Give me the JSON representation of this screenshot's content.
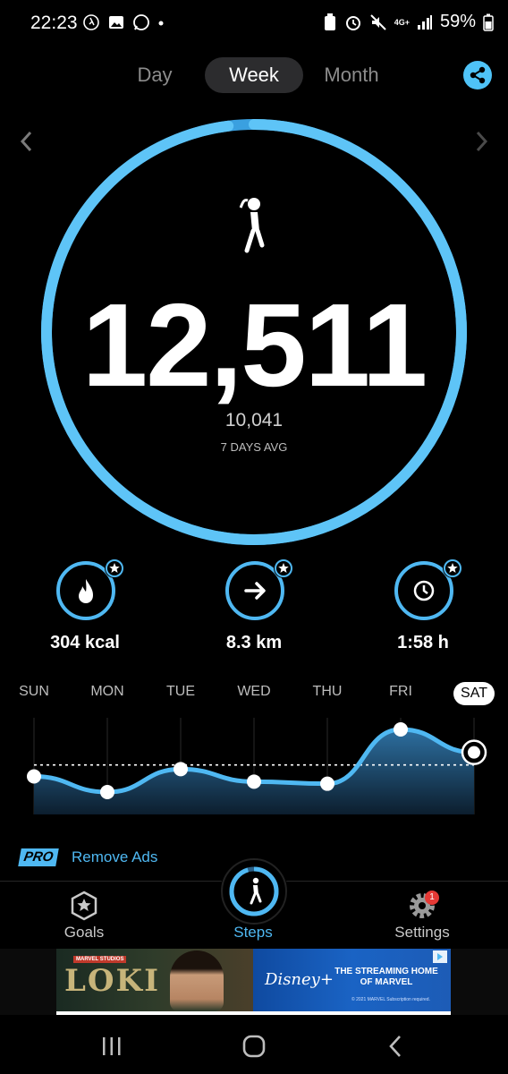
{
  "status_bar": {
    "time": "22:23",
    "battery": "59%",
    "network": "4G+"
  },
  "tabs": [
    {
      "label": "Day",
      "active": false
    },
    {
      "label": "Week",
      "active": true
    },
    {
      "label": "Month",
      "active": false
    }
  ],
  "icons": {
    "share": "share-icon",
    "walker": "walking-person-icon",
    "calories": "flame-icon",
    "distance": "arrow-right-icon",
    "time": "clock-icon",
    "goals": "star-badge-icon",
    "steps": "steps-icon",
    "settings": "gear-icon"
  },
  "summary": {
    "steps": "12,511",
    "avg_value": "10,041",
    "avg_label": "7 DAYS AVG",
    "ring_progress": 0.98
  },
  "stats": {
    "calories": "304 kcal",
    "distance": "8.3 km",
    "duration": "1:58 h"
  },
  "chart_data": {
    "type": "area",
    "categories": [
      "SUN",
      "MON",
      "TUE",
      "WED",
      "THU",
      "FRI",
      "SAT"
    ],
    "selected": "SAT",
    "relative_values": [
      0.55,
      0.4,
      0.62,
      0.5,
      0.48,
      1.0,
      0.78
    ],
    "average_line": 0.66
  },
  "promo": {
    "badge": "PRO",
    "text": "Remove Ads"
  },
  "bottom_nav": {
    "goals": "Goals",
    "steps": "Steps",
    "settings": "Settings",
    "settings_badge": "1"
  },
  "ad": {
    "brand_left": "LOKI",
    "marvel_tag": "MARVEL STUDIOS",
    "brand_right": "Disney+",
    "headline": "THE STREAMING HOME OF MARVEL",
    "fine_print": "© 2021 MARVEL Subscription required."
  },
  "colors": {
    "accent": "#4fb8f2",
    "background": "#000000"
  }
}
